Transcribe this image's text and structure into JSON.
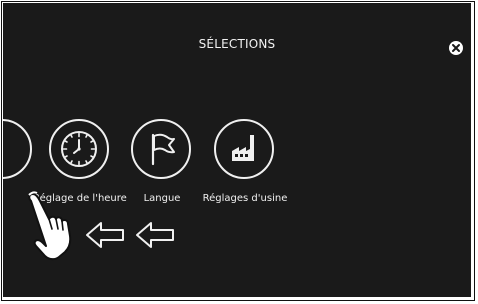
{
  "header": {
    "title": "SÉLECTIONS"
  },
  "items": [
    {
      "label": "",
      "icon": "partial-circle-icon"
    },
    {
      "label": "Réglage de l'heure",
      "icon": "clock-icon"
    },
    {
      "label": "Langue",
      "icon": "flag-icon"
    },
    {
      "label": "Réglages d'usine",
      "icon": "factory-icon"
    }
  ],
  "gesture": {
    "hand_icon": "pointing-hand-icon",
    "arrow_icon": "left-arrow-icon"
  },
  "colors": {
    "background": "#1a1a1a",
    "foreground": "#f0f0f0"
  }
}
